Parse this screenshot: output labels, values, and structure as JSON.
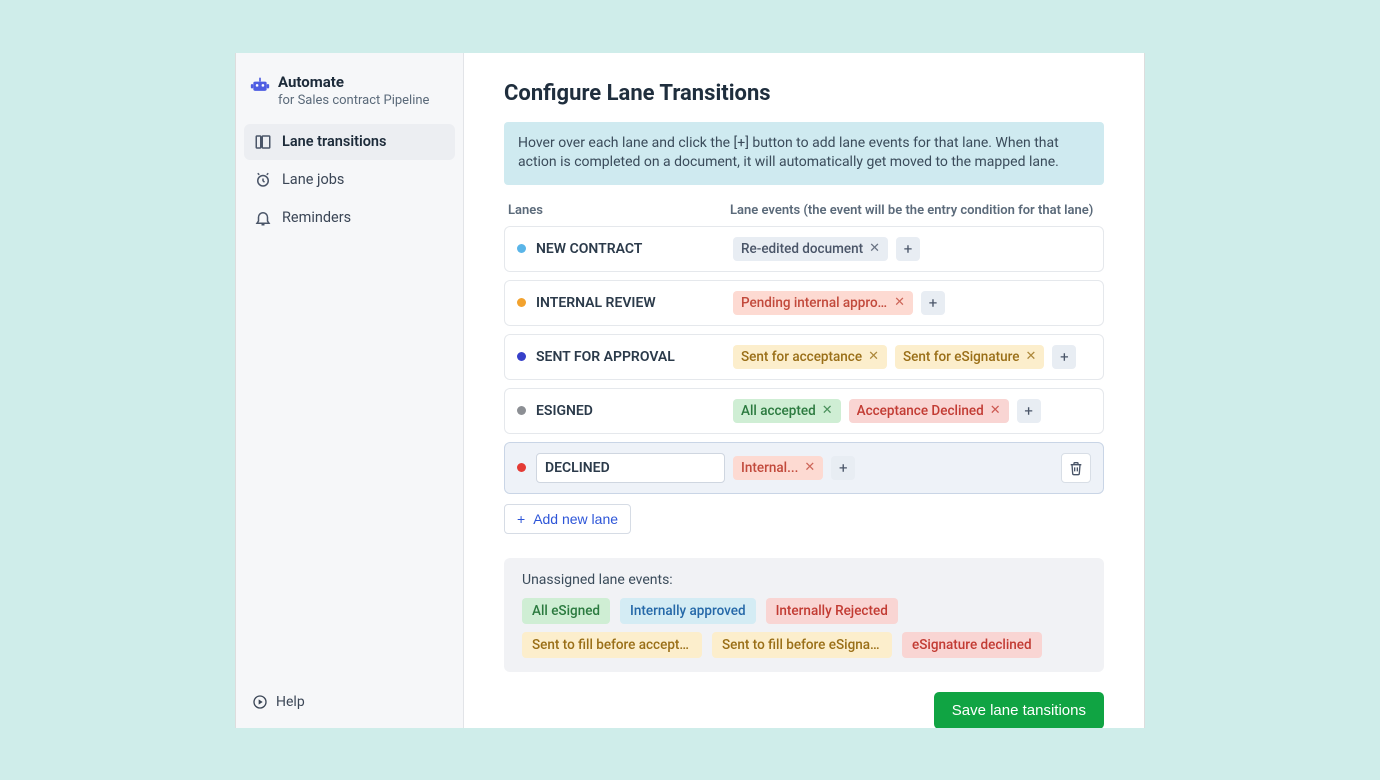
{
  "sidebar": {
    "brand_title": "Automate",
    "brand_subtitle": "for Sales contract Pipeline",
    "items": [
      {
        "label": "Lane transitions",
        "active": true
      },
      {
        "label": "Lane jobs",
        "active": false
      },
      {
        "label": "Reminders",
        "active": false
      }
    ],
    "help_label": "Help"
  },
  "header": {
    "title": "Configure Lane Transitions",
    "info": "Hover over each lane and click the [+] button to add lane events for that lane. When that action is completed on a document, it will automatically get moved to the mapped lane."
  },
  "columns": {
    "lanes": "Lanes",
    "events": "Lane events (the event will be the entry condition for that lane)"
  },
  "lanes": [
    {
      "name": "NEW CONTRACT",
      "color": "#5ab5e8",
      "selected": false,
      "events": [
        {
          "label": "Re-edited document",
          "chip_class": "blue"
        }
      ]
    },
    {
      "name": "INTERNAL REVIEW",
      "color": "#f2a22e",
      "selected": false,
      "events": [
        {
          "label": "Pending internal approval",
          "chip_class": "peach"
        }
      ]
    },
    {
      "name": "SENT FOR APPROVAL",
      "color": "#3740c9",
      "selected": false,
      "events": [
        {
          "label": "Sent for acceptance",
          "chip_class": "yellow"
        },
        {
          "label": "Sent for eSignature",
          "chip_class": "yellow"
        }
      ]
    },
    {
      "name": "ESIGNED",
      "color": "#8c8f94",
      "selected": false,
      "events": [
        {
          "label": "All accepted",
          "chip_class": "green"
        },
        {
          "label": "Acceptance Declined",
          "chip_class": "red"
        }
      ]
    },
    {
      "name": "DECLINED",
      "color": "#e43b35",
      "selected": true,
      "events": [
        {
          "label": "Internal...",
          "chip_class": "peach"
        }
      ]
    }
  ],
  "add_lane_label": "Add new lane",
  "unassigned": {
    "title": "Unassigned lane events:",
    "events": [
      {
        "label": "All eSigned",
        "chip_class": "green"
      },
      {
        "label": "Internally approved",
        "chip_class": "teal"
      },
      {
        "label": "Internally Rejected",
        "chip_class": "red"
      },
      {
        "label": "Sent to fill before acceptance",
        "chip_class": "yellow"
      },
      {
        "label": "Sent to fill before eSignature",
        "chip_class": "yellow"
      },
      {
        "label": "eSignature declined",
        "chip_class": "red"
      }
    ]
  },
  "save_label": "Save lane tansitions"
}
